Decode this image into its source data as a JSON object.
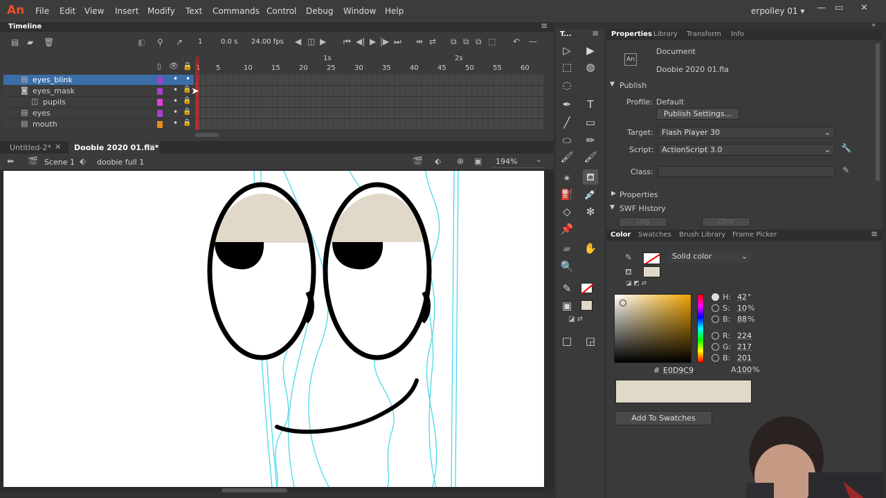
{
  "app": {
    "logo": "An",
    "user": "erpolley 01 ▾"
  },
  "menu": [
    "File",
    "Edit",
    "View",
    "Insert",
    "Modify",
    "Text",
    "Commands",
    "Control",
    "Debug",
    "Window",
    "Help"
  ],
  "timeline": {
    "title": "Timeline",
    "current_frame": "1",
    "time": "0.0 s",
    "fps": "24.00 fps",
    "ruler": [
      "1",
      "5",
      "10",
      "15",
      "20",
      "25",
      "30",
      "35",
      "40",
      "45",
      "50",
      "55",
      "60"
    ],
    "seconds": [
      "1s",
      "2s"
    ],
    "layers": [
      {
        "name": "eyes_blink",
        "color": "#a73fd1",
        "selected": true
      },
      {
        "name": "eyes_mask",
        "color": "#a73fd1",
        "selected": false
      },
      {
        "name": "pupils",
        "color": "#e23fd6",
        "selected": false
      },
      {
        "name": "eyes",
        "color": "#a73fd1",
        "selected": false
      },
      {
        "name": "mouth",
        "color": "#e98a1c",
        "selected": false
      }
    ]
  },
  "doc_tabs": [
    {
      "label": "Untitled-2*"
    },
    {
      "label": "Doobie 2020 01.fla*",
      "active": true
    }
  ],
  "editbar": {
    "scene": "Scene 1",
    "symbol": "doobie full 1",
    "zoom": "194%"
  },
  "tools_panel": {
    "title": "T..."
  },
  "properties": {
    "tabs": [
      "Properties",
      "Library",
      "Transform",
      "Info"
    ],
    "doc_type": "Document",
    "doc_name": "Doobie 2020 01.fla",
    "publish": {
      "section": "Publish",
      "profile_label": "Profile:",
      "profile_value": "Default",
      "publish_settings": "Publish Settings...",
      "target_label": "Target:",
      "target_value": "Flash Player 30",
      "script_label": "Script:",
      "script_value": "ActionScript 3.0",
      "class_label": "Class:"
    },
    "properties_section": "Properties",
    "swf_history": "SWF History",
    "log": "Log",
    "clear": "Clear"
  },
  "color_panel": {
    "tabs": [
      "Color",
      "Swatches",
      "Brush Library",
      "Frame Picker"
    ],
    "fill_type": "Solid color",
    "H_label": "H:",
    "H": "42",
    "H_unit": "°",
    "S_label": "S:",
    "S": "10",
    "S_unit": "%",
    "B_label": "B:",
    "B": "88",
    "B_unit": "%",
    "R_label": "R:",
    "R": "224",
    "G_label": "G:",
    "G": "217",
    "Bv_label": "B:",
    "Bv": "201",
    "A_label": "A:",
    "A": "100",
    "A_unit": "%",
    "hex_label": "#",
    "hex": "E0D9C9",
    "add_swatch": "Add To Swatches",
    "fill_color": "#e0d9c9"
  }
}
